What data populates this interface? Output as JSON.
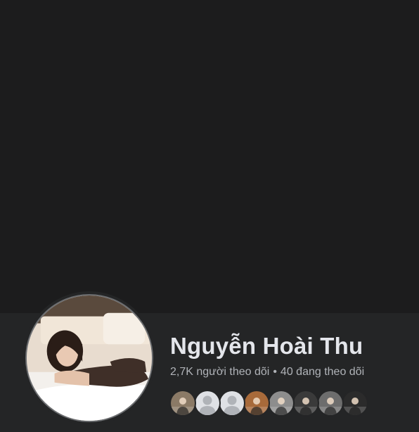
{
  "profile": {
    "name": "Nguyễn Hoài Thu",
    "followers_count": "2,7K",
    "followers_label": "người theo dõi",
    "following_count": "40",
    "following_label": "đang theo dõi",
    "separator": "•"
  },
  "colors": {
    "cover": "#1c1c1d",
    "band": "#242526",
    "name": "#e4e6eb",
    "stats": "#b0b3b8"
  },
  "follower_avatars": [
    {
      "kind": "photo",
      "tone": "#8b7a66"
    },
    {
      "kind": "default",
      "tone": "#b0b3b8"
    },
    {
      "kind": "default",
      "tone": "#b0b3b8"
    },
    {
      "kind": "photo",
      "tone": "#a86a3a"
    },
    {
      "kind": "photo",
      "tone": "#8d8d8d"
    },
    {
      "kind": "photo",
      "tone": "#3a3a3a"
    },
    {
      "kind": "photo",
      "tone": "#6d6d6d"
    },
    {
      "kind": "photo",
      "tone": "#2b2b2b"
    }
  ]
}
